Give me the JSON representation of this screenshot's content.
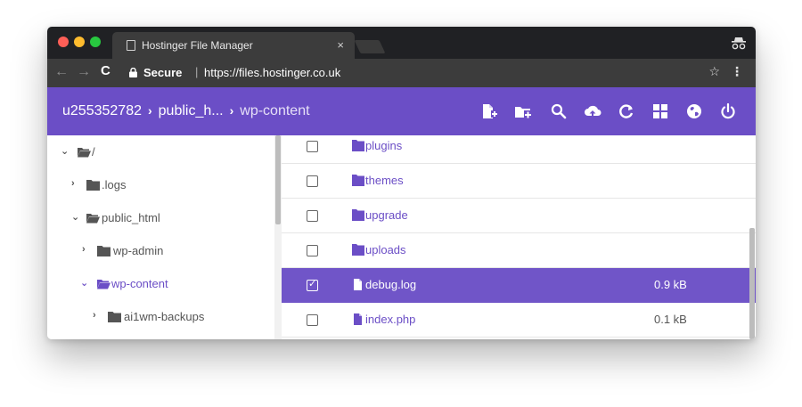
{
  "browser": {
    "tab_title": "Hostinger File Manager",
    "tab_close": "×",
    "secure_label": "Secure",
    "separator": "|",
    "url": "https://files.hostinger.co.uk",
    "traffic_lights": [
      "#fe5f57",
      "#febc2e",
      "#28c840"
    ],
    "icons": [
      "page-icon",
      "incognito-icon",
      "back-arrow-icon",
      "forward-arrow-icon",
      "reload-icon",
      "lock-icon",
      "star-icon",
      "menu-icon"
    ]
  },
  "header": {
    "breadcrumbs": [
      "u255352782",
      "public_h...",
      "wp-content"
    ],
    "breadcrumb_separator": "›",
    "accent": "#6b4ec6",
    "toolbar_icons": [
      "new-file-icon",
      "new-folder-icon",
      "search-icon",
      "upload-icon",
      "refresh-icon",
      "grid-view-icon",
      "globe-icon",
      "power-icon"
    ]
  },
  "tree": {
    "items": [
      {
        "label": "/",
        "expanded": true,
        "active": false
      },
      {
        "label": ".logs",
        "expanded": false,
        "active": false
      },
      {
        "label": "public_html",
        "expanded": true,
        "active": false
      },
      {
        "label": "wp-admin",
        "expanded": false,
        "active": false
      },
      {
        "label": "wp-content",
        "expanded": true,
        "active": true
      },
      {
        "label": "ai1wm-backups",
        "expanded": false,
        "active": false
      }
    ]
  },
  "files": {
    "rows": [
      {
        "name": "plugins",
        "type": "folder",
        "size": "",
        "checked": false
      },
      {
        "name": "themes",
        "type": "folder",
        "size": "",
        "checked": false
      },
      {
        "name": "upgrade",
        "type": "folder",
        "size": "",
        "checked": false
      },
      {
        "name": "uploads",
        "type": "folder",
        "size": "",
        "checked": false
      },
      {
        "name": "debug.log",
        "type": "file",
        "size": "0.9 kB",
        "checked": true
      },
      {
        "name": "index.php",
        "type": "file",
        "size": "0.1 kB",
        "checked": false
      }
    ],
    "selected_color": "#7055c8"
  }
}
